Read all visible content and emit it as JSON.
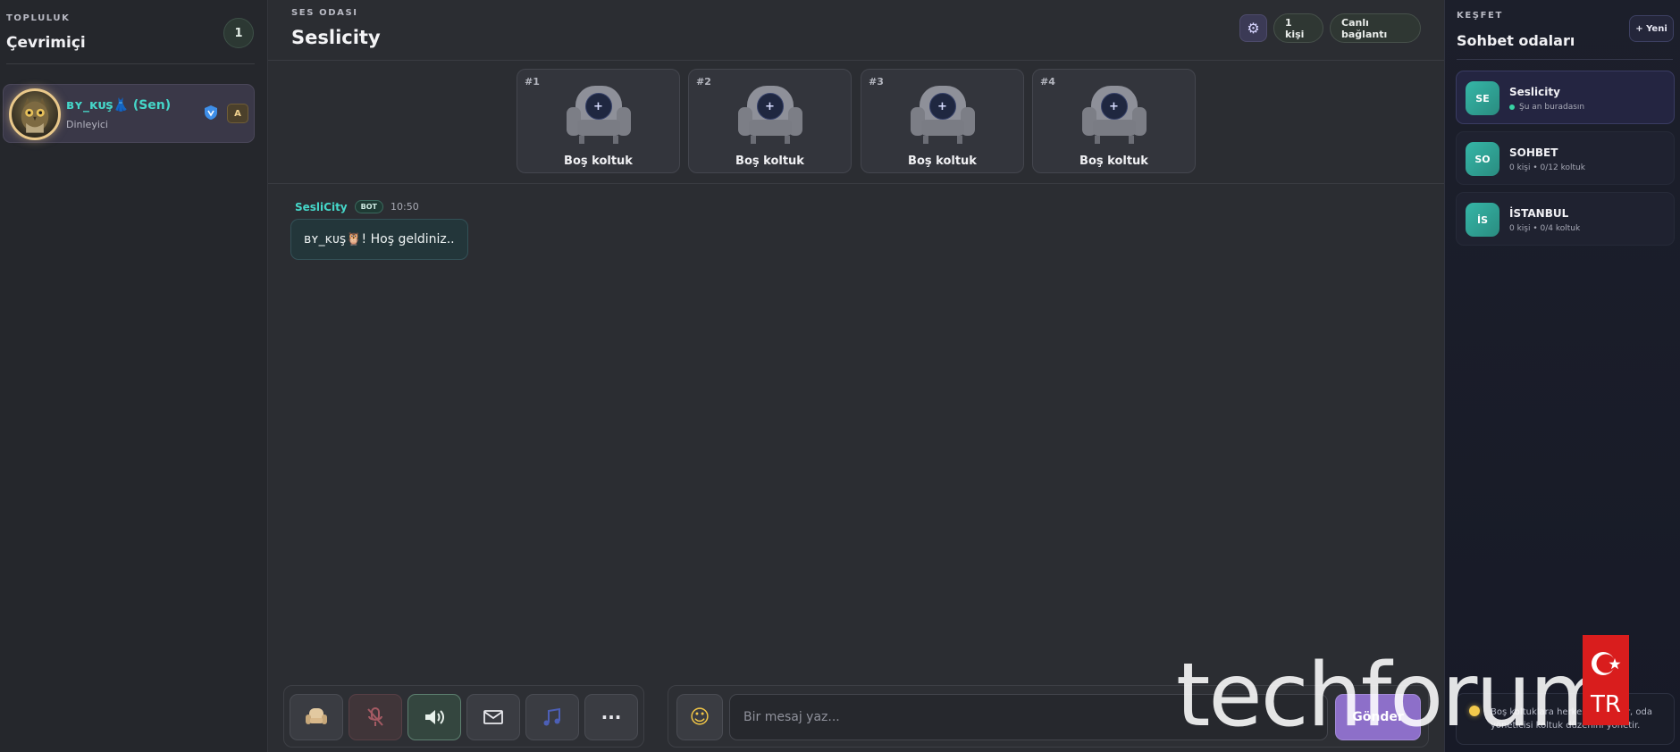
{
  "left_panel": {
    "kicker": "TOPLULUK",
    "title": "Çevrimiçi",
    "online_count": "1",
    "members": [
      {
        "name": "ʙʏ_ᴋᴜş👗 (Sen)",
        "role": "Dinleyici",
        "badge": "A"
      }
    ]
  },
  "room": {
    "kicker": "SES ODASI",
    "title": "Seslicity",
    "people_label": "1 kişi",
    "live_label": "Canlı bağlantı",
    "seats": [
      {
        "number": "#1",
        "label": "Boş koltuk"
      },
      {
        "number": "#2",
        "label": "Boş koltuk"
      },
      {
        "number": "#3",
        "label": "Boş koltuk"
      },
      {
        "number": "#4",
        "label": "Boş koltuk"
      }
    ]
  },
  "chat": {
    "messages": [
      {
        "author": "SesliCity",
        "tag": "BOT",
        "time": "10:50",
        "text": "ʙʏ_ᴋᴜş🦉! Hoş geldiniz.."
      }
    ],
    "input_placeholder": "Bir mesaj yaz...",
    "send_label": "Gönder"
  },
  "toolbar": {
    "buttons": [
      {
        "icon": "armchair-icon"
      },
      {
        "icon": "mic-muted-icon"
      },
      {
        "icon": "speaker-icon"
      },
      {
        "icon": "mail-icon"
      },
      {
        "icon": "music-icon"
      },
      {
        "icon": "more-icon",
        "glyph": "···"
      }
    ]
  },
  "right_panel": {
    "kicker": "KEŞFET",
    "title": "Sohbet odaları",
    "new_label": "+ Yeni",
    "rooms": [
      {
        "abbr": "SE",
        "name": "Seslicity",
        "sub": "Şu an buradasın",
        "active": true
      },
      {
        "abbr": "SO",
        "name": "SOHBET",
        "sub": "0 kişi • 0/12 koltuk",
        "active": false
      },
      {
        "abbr": "İS",
        "name": "İSTANBUL",
        "sub": "0 kişi • 0/4 koltuk",
        "active": false
      }
    ],
    "tip": "Boş koltuklara herkes oturabilir, oda yöneticisi koltuk düzenini yönetir."
  },
  "watermark": {
    "text": "techforum",
    "flag_text": "TR"
  },
  "colors": {
    "accent_teal": "#45d7c9",
    "send_purple": "#8d6fc9",
    "admin_gold": "#f1d28f"
  }
}
